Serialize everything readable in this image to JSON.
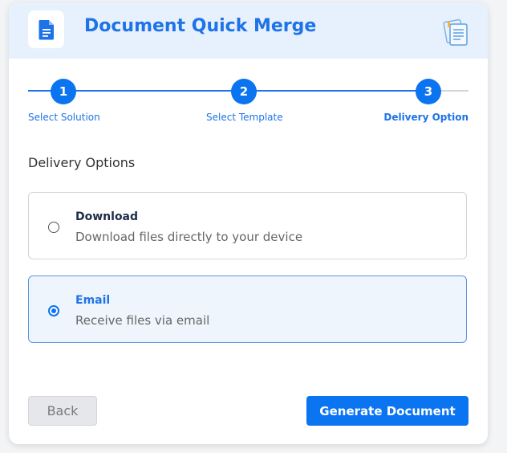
{
  "header": {
    "title": "Document Quick Merge",
    "logo_icon": "document-icon",
    "decor_icon": "documents-icon",
    "accent_color": "#1e73e8"
  },
  "stepper": {
    "steps": [
      {
        "number": "1",
        "label": "Select Solution",
        "status": "complete"
      },
      {
        "number": "2",
        "label": "Select Template",
        "status": "complete"
      },
      {
        "number": "3",
        "label": "Delivery Option",
        "status": "active"
      }
    ]
  },
  "delivery": {
    "section_title": "Delivery Options",
    "options": [
      {
        "title": "Download",
        "description": "Download files directly to your device",
        "selected": false
      },
      {
        "title": "Email",
        "description": "Receive files via email",
        "selected": true
      }
    ]
  },
  "actions": {
    "back_label": "Back",
    "generate_label": "Generate Document"
  }
}
